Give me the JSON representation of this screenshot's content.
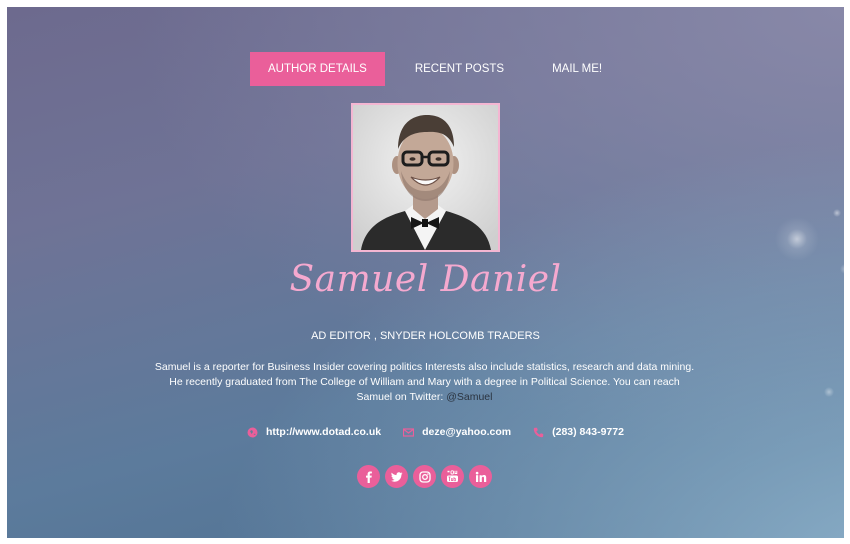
{
  "tabs": [
    {
      "label": "AUTHOR DETAILS",
      "active": true
    },
    {
      "label": "RECENT POSTS",
      "active": false
    },
    {
      "label": "MAIL ME!",
      "active": false
    }
  ],
  "author": {
    "name": "Samuel Daniel",
    "title": "AD EDITOR , SNYDER HOLCOMB TRADERS",
    "bio_text": "Samuel is a reporter for Business Insider covering politics Interests also include statistics, research and data mining. He recently graduated from The College of William and Mary with a degree in Political Science. You can reach Samuel on Twitter: ",
    "twitter_handle": "@Samuel"
  },
  "contacts": {
    "website": {
      "icon": "globe-icon",
      "text": "http://www.dotad.co.uk"
    },
    "email": {
      "icon": "envelope-icon",
      "text": "deze@yahoo.com"
    },
    "phone": {
      "icon": "phone-icon",
      "text": "(283) 843-9772"
    }
  },
  "socials": [
    "facebook-icon",
    "twitter-icon",
    "instagram-icon",
    "youtube-icon",
    "linkedin-icon"
  ],
  "colors": {
    "accent": "#ea5f9a",
    "name": "#f5a9cf",
    "avatar_border": "#f4b6d2"
  }
}
